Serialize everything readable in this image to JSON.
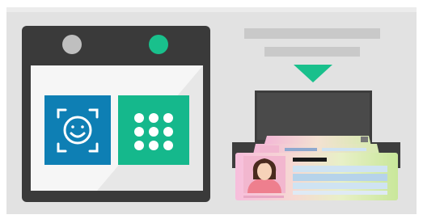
{
  "kiosk": {
    "indicators": {
      "left_color": "#bfbfbf",
      "right_color": "#19c08c"
    },
    "auth_options": [
      {
        "id": "face",
        "icon": "face-recognition-icon",
        "color": "#0e7fb4"
      },
      {
        "id": "pin",
        "icon": "keypad-icon",
        "color": "#15b88c"
      }
    ],
    "card_slot": {
      "arrow_color": "#19c08c",
      "arrow_direction": "down"
    },
    "id_cards": [
      {
        "style": "rainbow-gradient",
        "has_photo": true,
        "stacked_count": 3
      }
    ]
  },
  "colors": {
    "kiosk_body": "#e2e2e2",
    "screen_frame": "#3a3a3a",
    "screen_background": "#f6f6f6",
    "slot_dark": "#3d3d3d"
  }
}
